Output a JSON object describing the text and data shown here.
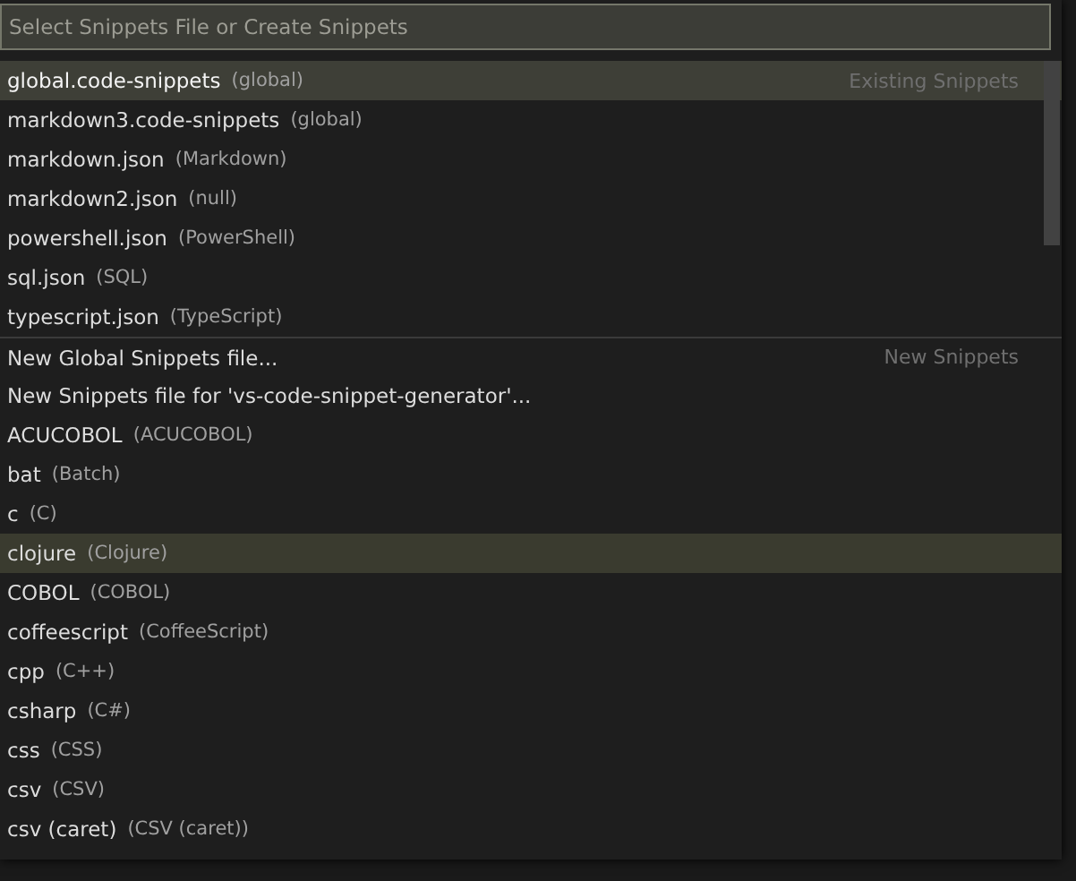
{
  "search": {
    "placeholder": "Select Snippets File or Create Snippets"
  },
  "groups": [
    {
      "label": "Existing Snippets",
      "items": [
        {
          "name": "global.code-snippets",
          "detail": "(global)",
          "selected": true,
          "hovered": false
        },
        {
          "name": "markdown3.code-snippets",
          "detail": "(global)",
          "selected": false,
          "hovered": false
        },
        {
          "name": "markdown.json",
          "detail": "(Markdown)",
          "selected": false,
          "hovered": false
        },
        {
          "name": "markdown2.json",
          "detail": "(null)",
          "selected": false,
          "hovered": false
        },
        {
          "name": "powershell.json",
          "detail": "(PowerShell)",
          "selected": false,
          "hovered": false
        },
        {
          "name": "sql.json",
          "detail": "(SQL)",
          "selected": false,
          "hovered": false
        },
        {
          "name": "typescript.json",
          "detail": "(TypeScript)",
          "selected": false,
          "hovered": false
        }
      ]
    },
    {
      "label": "New Snippets",
      "items": [
        {
          "name": "New Global Snippets file...",
          "selected": false,
          "hovered": false
        },
        {
          "name": "New Snippets file for 'vs-code-snippet-generator'...",
          "selected": false,
          "hovered": false
        },
        {
          "name": "ACUCOBOL",
          "detail": "(ACUCOBOL)",
          "selected": false,
          "hovered": false
        },
        {
          "name": "bat",
          "detail": "(Batch)",
          "selected": false,
          "hovered": false
        },
        {
          "name": "c",
          "detail": "(C)",
          "selected": false,
          "hovered": false
        },
        {
          "name": "clojure",
          "detail": "(Clojure)",
          "selected": false,
          "hovered": true
        },
        {
          "name": "COBOL",
          "detail": "(COBOL)",
          "selected": false,
          "hovered": false
        },
        {
          "name": "coffeescript",
          "detail": "(CoffeeScript)",
          "selected": false,
          "hovered": false
        },
        {
          "name": "cpp",
          "detail": "(C++)",
          "selected": false,
          "hovered": false
        },
        {
          "name": "csharp",
          "detail": "(C#)",
          "selected": false,
          "hovered": false
        },
        {
          "name": "css",
          "detail": "(CSS)",
          "selected": false,
          "hovered": false
        },
        {
          "name": "csv",
          "detail": "(CSV)",
          "selected": false,
          "hovered": false
        },
        {
          "name": "csv (caret)",
          "detail": "(CSV (caret))",
          "selected": false,
          "hovered": false
        }
      ]
    }
  ]
}
